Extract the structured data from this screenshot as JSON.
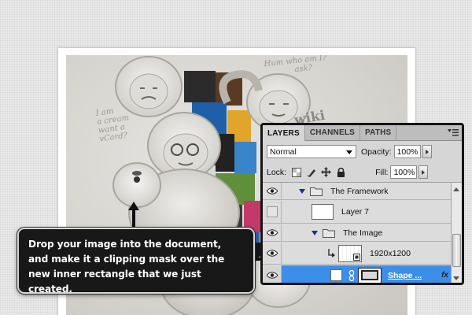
{
  "document": {
    "doodles": {
      "left": [
        "I am",
        "a cream",
        "want a",
        "vCard?"
      ],
      "top": [
        "Hum who am I?",
        "ask?"
      ],
      "wiki": "wiki"
    }
  },
  "callout": {
    "text": "Drop your image into the document, and make it a clipping mask over the new inner rectangle that we just created."
  },
  "layers_panel": {
    "tabs": [
      {
        "label": "LAYERS",
        "active": true
      },
      {
        "label": "CHANNELS",
        "active": false
      },
      {
        "label": "PATHS",
        "active": false
      }
    ],
    "menu_icon": "panel-menu-icon",
    "blend_mode": "Normal",
    "opacity_label": "Opacity:",
    "opacity_value": "100%",
    "lock_label": "Lock:",
    "fill_label": "Fill:",
    "fill_value": "100%",
    "layers": [
      {
        "name": "The Framework",
        "type": "group",
        "visible": true,
        "expanded": true
      },
      {
        "name": "Layer 7",
        "type": "layer",
        "visible": false
      },
      {
        "name": "The Image",
        "type": "group",
        "visible": true,
        "expanded": true
      },
      {
        "name": "1920x1200",
        "type": "smart-object",
        "visible": true,
        "clipped": true
      },
      {
        "name": "Shape ...",
        "type": "shape",
        "visible": true,
        "selected": true,
        "fx": "fx"
      }
    ],
    "colors": {
      "selected_row": "#3d8ee8",
      "panel_bg": "#d6d6d6",
      "border": "#151515"
    }
  }
}
